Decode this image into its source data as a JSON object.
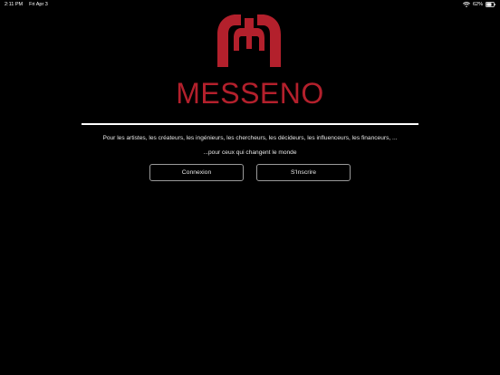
{
  "status_bar": {
    "time": "2:11 PM",
    "date": "Fri Apr 3",
    "battery": "62%"
  },
  "brand": {
    "name": "MESSENO",
    "logo_icon": "messeno-logo-icon",
    "color": "#b3202c"
  },
  "intro": {
    "tagline": "Pour les artistes, les créateurs, les ingénieurs, les chercheurs, les décideurs, les influenceurs, les financeurs, ...",
    "subtagline": "...pour ceux qui changent le monde"
  },
  "actions": {
    "login_label": "Connexion",
    "signup_label": "S'Inscrire"
  }
}
